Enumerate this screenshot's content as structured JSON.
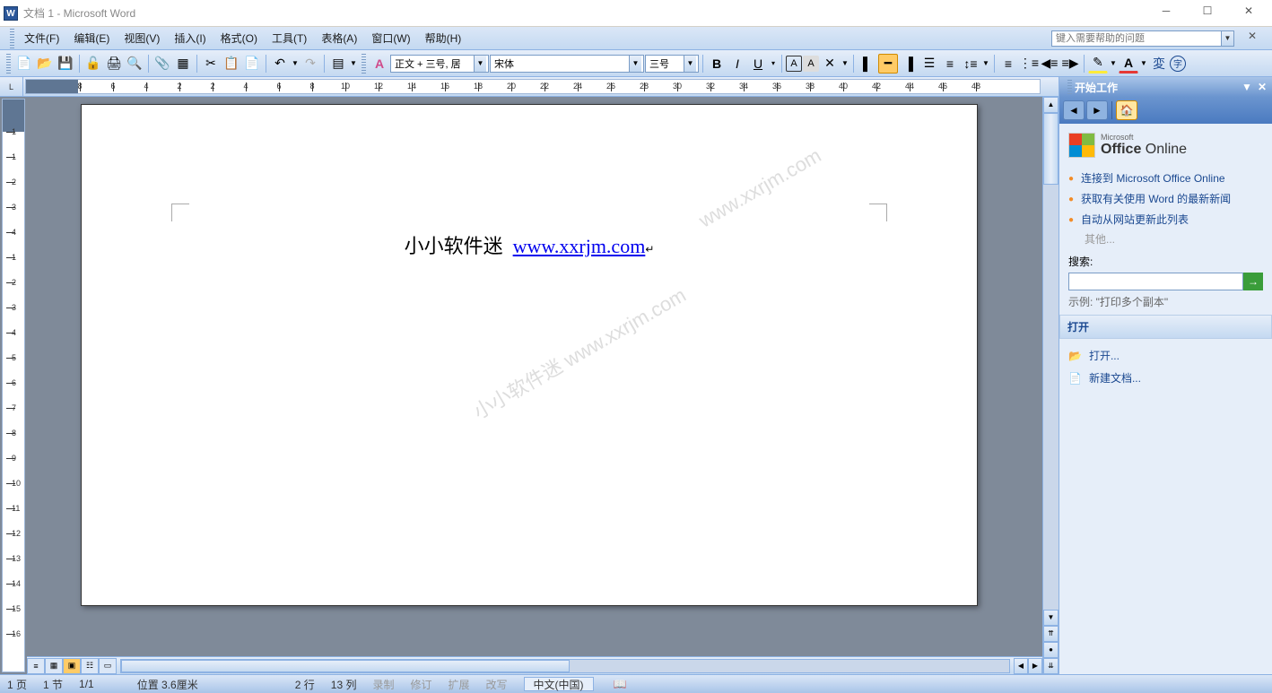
{
  "title": "文档 1 - Microsoft Word",
  "menu": [
    "文件(F)",
    "编辑(E)",
    "视图(V)",
    "插入(I)",
    "格式(O)",
    "工具(T)",
    "表格(A)",
    "窗口(W)",
    "帮助(H)"
  ],
  "help_placeholder": "键入需要帮助的问题",
  "style_combo": "正文 + 三号, 居",
  "font_combo": "宋体",
  "size_combo": "三号",
  "document": {
    "text": "小小软件迷",
    "link": "www.xxrjm.com",
    "watermark1": "小小软件迷 www.xxrjm.com",
    "watermark2": "www.xxrjm.com"
  },
  "taskpane": {
    "title": "开始工作",
    "office_brand_small": "Microsoft",
    "office_brand": "Office Online",
    "links": [
      "连接到 Microsoft Office Online",
      "获取有关使用 Word 的最新新闻",
      "自动从网站更新此列表"
    ],
    "other": "其他...",
    "search_label": "搜索:",
    "example": "示例:    \"打印多个副本\"",
    "open_section": "打开",
    "open_link": "打开...",
    "new_doc": "新建文档..."
  },
  "status": {
    "page": "1 页",
    "section": "1 节",
    "pages": "1/1",
    "position": "位置 3.6厘米",
    "line": "2 行",
    "col": "13 列",
    "rec": "录制",
    "rev": "修订",
    "ext": "扩展",
    "ovr": "改写",
    "lang": "中文(中国)"
  },
  "ruler_numbers": [
    8,
    6,
    4,
    2,
    2,
    4,
    6,
    8,
    10,
    12,
    14,
    16,
    18,
    20,
    22,
    24,
    26,
    28,
    30,
    32,
    34,
    36,
    38,
    40,
    42,
    44,
    46,
    48
  ]
}
